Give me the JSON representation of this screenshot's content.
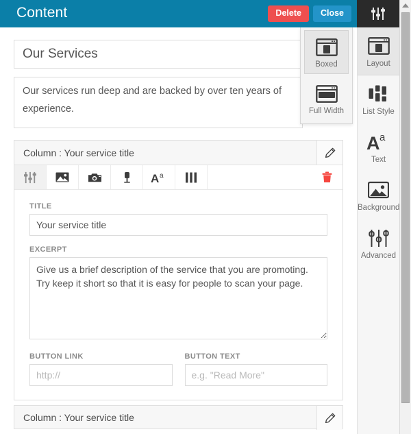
{
  "header": {
    "title": "Content",
    "delete_label": "Delete",
    "close_label": "Close",
    "settings_icon": "sliders-icon",
    "bg_color": "#0b7fa8",
    "delete_color": "#ee4f4f",
    "close_color": "#2394c9",
    "dark_color": "#2a2a2a"
  },
  "content": {
    "section_title_value": "Our Services",
    "section_title_placeholder": "",
    "section_description_value": "Our services run deep and are backed by over ten years of experience.",
    "section_description_placeholder": ""
  },
  "column_open": {
    "header_label": "Column : Your service title",
    "edit_icon": "pencil-icon",
    "toolbar": [
      {
        "name": "settings",
        "icon": "sliders-icon",
        "active": true
      },
      {
        "name": "image",
        "icon": "image-icon",
        "active": false
      },
      {
        "name": "camera",
        "icon": "camera-icon",
        "active": false
      },
      {
        "name": "map-pin",
        "icon": "map-pin-icon",
        "active": false
      },
      {
        "name": "text",
        "icon": "text-aa-icon",
        "active": false
      },
      {
        "name": "columns",
        "icon": "columns-icon",
        "active": false
      }
    ],
    "delete_icon": "trash-icon",
    "delete_color": "#f6463f",
    "fields": {
      "title_label": "TITLE",
      "title_value": "Your service title",
      "title_placeholder": "",
      "excerpt_label": "EXCERPT",
      "excerpt_value": "Give us a brief description of the service that you are promoting. Try keep it short so that it is easy for people to scan your page.",
      "excerpt_placeholder": "",
      "button_link_label": "BUTTON LINK",
      "button_link_value": "",
      "button_link_placeholder": "http://",
      "button_text_label": "BUTTON TEXT",
      "button_text_value": "",
      "button_text_placeholder": "e.g. \"Read More\""
    }
  },
  "column_collapsed": {
    "header_label": "Column : Your service title",
    "edit_icon": "pencil-icon"
  },
  "layout_dropdown": {
    "options": [
      {
        "label": "Boxed",
        "icon": "boxed-layout-icon",
        "selected": true
      },
      {
        "label": "Full Width",
        "icon": "full-width-layout-icon",
        "selected": false
      }
    ]
  },
  "sidebar": {
    "items": [
      {
        "label": "Layout",
        "icon": "layout-icon",
        "active": true
      },
      {
        "label": "List Style",
        "icon": "list-style-icon",
        "active": false
      },
      {
        "label": "Text",
        "icon": "text-aa-icon",
        "active": false
      },
      {
        "label": "Background",
        "icon": "background-image-icon",
        "active": false
      },
      {
        "label": "Advanced",
        "icon": "sliders-icon",
        "active": false
      }
    ]
  },
  "scrollbar": {
    "up_arrow_icon": "scroll-up-arrow-icon"
  }
}
